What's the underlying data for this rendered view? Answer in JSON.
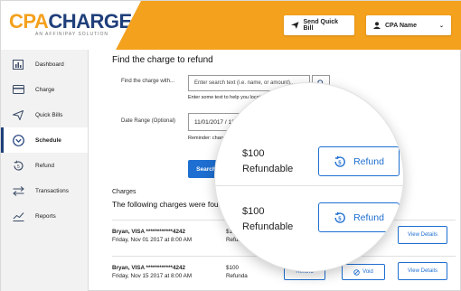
{
  "header": {
    "logo_cpa": "CPA",
    "logo_charge": "CHARGE",
    "logo_tagline": "AN AFFINIPAY SOLUTION",
    "quick_bill_label": "Send Quick Bill",
    "user_label": "CPA Name"
  },
  "sidebar": {
    "items": [
      {
        "label": "Dashboard",
        "icon": "dashboard-icon"
      },
      {
        "label": "Charge",
        "icon": "card-icon"
      },
      {
        "label": "Quick Bills",
        "icon": "send-icon"
      },
      {
        "label": "Schedule",
        "icon": "chevron-circle-icon",
        "active": true
      },
      {
        "label": "Refund",
        "icon": "refund-icon"
      },
      {
        "label": "Transactions",
        "icon": "transfer-icon"
      },
      {
        "label": "Reports",
        "icon": "chart-icon"
      }
    ]
  },
  "main": {
    "title": "Find the charge to refund",
    "search_label": "Find the charge with...",
    "search_placeholder": "Enter search text (i.e. name, or amount)...",
    "search_hint": "Enter some text to help you locate the ch",
    "date_label": "Date Range (Optional)",
    "date_value": "11/01/2017 / 12/25/20",
    "reminder": "Reminder: charges c refundable.",
    "search_button": "Search",
    "section": "Charges",
    "section_sub": "The following charges were found",
    "rows": [
      {
        "name": "Bryan, VISA ************4242",
        "date": "Friday, Nov 01 2017 at 8:00 AM",
        "amount": "$100",
        "status": "Refunda",
        "view": "View Details"
      },
      {
        "name": "Bryan, VISA ************4242",
        "date": "Friday, Nov 15 2017 at 8:00 AM",
        "amount": "$100",
        "status": "Refunda",
        "refund": "Refund",
        "void": "Void",
        "view": "View Details"
      }
    ]
  },
  "magnifier": {
    "rows": [
      {
        "amount": "$100",
        "status": "Refundable",
        "button": "Refund"
      },
      {
        "amount": "$100",
        "status": "Refundable",
        "button": "Refund"
      }
    ]
  },
  "colors": {
    "brand_orange": "#f4a11d",
    "brand_navy": "#1f3f7a",
    "accent_blue": "#1e6fd1"
  }
}
